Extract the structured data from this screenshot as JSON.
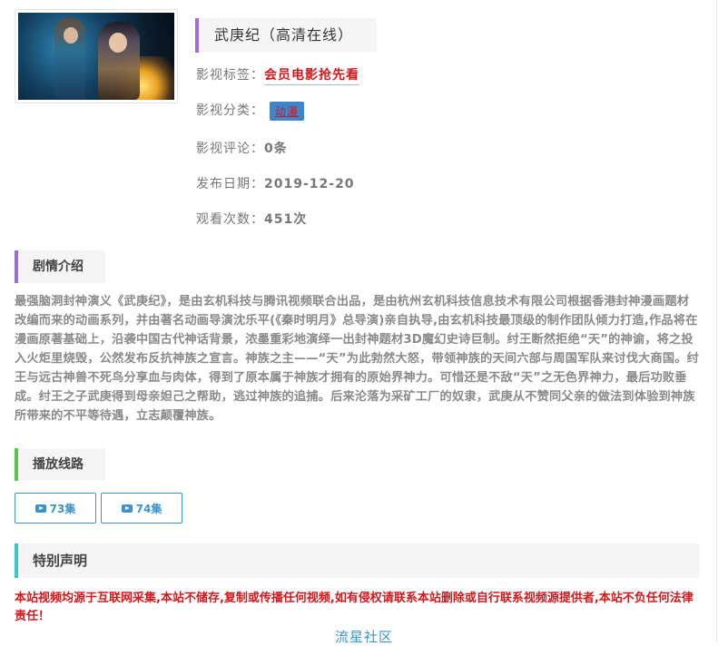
{
  "movie": {
    "title": "武庚纪（高清在线）",
    "tag_label": "影视标签：",
    "tag_value": "会员电影抢先看",
    "category_label": "影视分类：",
    "category_value": "动漫",
    "comments_label": "影视评论：",
    "comments_value": "0条",
    "date_label": "发布日期：",
    "date_value": "2019-12-20",
    "views_label": "观看次数：",
    "views_value": "451次"
  },
  "synopsis": {
    "heading": "剧情介绍",
    "text": "最强脑洞封神演义《武庚纪》，是由玄机科技与腾讯视频联合出品，是由杭州玄机科技信息技术有限公司根据香港封神漫画题材改编而来的动画系列，并由著名动画导演沈乐平(《秦时明月》总导演)亲自执导,由玄机科技最顶级的制作团队倾力打造,作品将在漫画原著基础上，沿袭中国古代神话背景，浓墨重彩地演绎一出封神题材3D魔幻史诗巨制。纣王断然拒绝“天”的神谕，将之投入火炬里烧毁，公然发布反抗神族之宣言。神族之主——“天”为此勃然大怒，带领神族的天间六部与周国军队来讨伐大商国。纣王与远古神兽不死鸟分享血与肉体，得到了原本属于神族才拥有的原始界神力。可惜还是不敌“天”之无色界神力，最后功败垂成。纣王之子武庚得到母亲妲己之帮助，逃过神族的追捕。后来沦落为采矿工厂的奴隶，武庚从不赞同父亲的做法到体验到神族所带来的不平等待遇，立志颠覆神族。"
  },
  "playlist": {
    "heading": "播放线路",
    "episodes": [
      "73集",
      "74集"
    ]
  },
  "notice": {
    "heading": "特别声明",
    "text": "本站视频均源于互联网采集,本站不储存,复制或传播任何视频,如有侵权请联系本站删除或自行联系视频源提供者,本站不负任何法律责任！"
  },
  "footer": {
    "link": "流星社区"
  },
  "colors": {
    "title_accent": "#a06ad9",
    "playlist_accent": "#55c94a",
    "notice_accent": "#39c6c6",
    "link_red": "#d3181c",
    "button_blue": "#3d93c9"
  },
  "icons": {
    "episode_button_icon": "play-video-icon"
  }
}
